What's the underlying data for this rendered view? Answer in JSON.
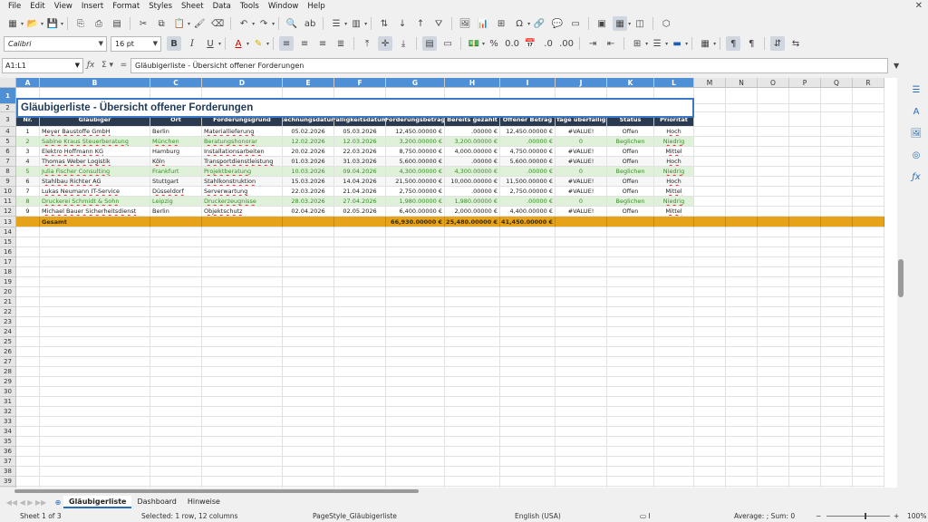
{
  "menu": [
    "File",
    "Edit",
    "View",
    "Insert",
    "Format",
    "Styles",
    "Sheet",
    "Data",
    "Tools",
    "Window",
    "Help"
  ],
  "font": {
    "name": "Calibri",
    "size": "16 pt"
  },
  "namebox": "A1:L1",
  "formula": "Gläubigerliste - Übersicht offener Forderungen",
  "columns": [
    "A",
    "B",
    "C",
    "D",
    "E",
    "F",
    "G",
    "H",
    "I",
    "J",
    "K",
    "L",
    "M",
    "N",
    "O",
    "P",
    "Q",
    "R"
  ],
  "title": "Gläubigerliste - Übersicht offener Forderungen",
  "headers": [
    "Nr.",
    "Gläubiger",
    "Ort",
    "Forderungsgrund",
    "Rechnungsdatum",
    "Fälligkeitsdatum",
    "Forderungsbetrag",
    "Bereits gezahlt",
    "Offener Betrag",
    "Tage überfällig",
    "Status",
    "Priorität"
  ],
  "rows": [
    [
      "1",
      "Meyer Baustoffe GmbH",
      "Berlin",
      "Materiallieferung",
      "05.02.2026",
      "05.03.2026",
      "12,450.00000 €",
      ".00000 €",
      "12,450.00000 €",
      "#VALUE!",
      "Offen",
      "Hoch"
    ],
    [
      "2",
      "Sabine Kraus Steuerberatung",
      "München",
      "Beratungshonorar",
      "12.02.2026",
      "12.03.2026",
      "3,200.00000 €",
      "3,200.00000 €",
      ".00000 €",
      "0",
      "Beglichen",
      "Niedrig"
    ],
    [
      "3",
      "Elektro Hoffmann KG",
      "Hamburg",
      "Installationsarbeiten",
      "20.02.2026",
      "22.03.2026",
      "8,750.00000 €",
      "4,000.00000 €",
      "4,750.00000 €",
      "#VALUE!",
      "Offen",
      "Mittel"
    ],
    [
      "4",
      "Thomas Weber Logistik",
      "Köln",
      "Transportdienstleistung",
      "01.03.2026",
      "31.03.2026",
      "5,600.00000 €",
      ".00000 €",
      "5,600.00000 €",
      "#VALUE!",
      "Offen",
      "Hoch"
    ],
    [
      "5",
      "Julia Fischer Consulting",
      "Frankfurt",
      "Projektberatung",
      "10.03.2026",
      "09.04.2026",
      "4,300.00000 €",
      "4,300.00000 €",
      ".00000 €",
      "0",
      "Beglichen",
      "Niedrig"
    ],
    [
      "6",
      "Stahlbau Richter AG",
      "Stuttgart",
      "Stahlkonstruktion",
      "15.03.2026",
      "14.04.2026",
      "21,500.00000 €",
      "10,000.00000 €",
      "11,500.00000 €",
      "#VALUE!",
      "Offen",
      "Hoch"
    ],
    [
      "7",
      "Lukas Neumann IT-Service",
      "Düsseldorf",
      "Serverwartung",
      "22.03.2026",
      "21.04.2026",
      "2,750.00000 €",
      ".00000 €",
      "2,750.00000 €",
      "#VALUE!",
      "Offen",
      "Mittel"
    ],
    [
      "8",
      "Druckerei Schmidt & Sohn",
      "Leipzig",
      "Druckerzeugnisse",
      "28.03.2026",
      "27.04.2026",
      "1,980.00000 €",
      "1,980.00000 €",
      ".00000 €",
      "0",
      "Beglichen",
      "Niedrig"
    ],
    [
      "9",
      "Michael Bauer Sicherheitsdienst",
      "Berlin",
      "Objektschutz",
      "02.04.2026",
      "02.05.2026",
      "6,400.00000 €",
      "2,000.00000 €",
      "4,400.00000 €",
      "#VALUE!",
      "Offen",
      "Mittel"
    ]
  ],
  "total": {
    "label": "Gesamt",
    "forderung": "66,930.00000 €",
    "gezahlt": "25,480.00000 €",
    "offen": "41,450.00000 €"
  },
  "tabs": [
    "Gläubigerliste",
    "Dashboard",
    "Hinweise"
  ],
  "status": {
    "sheet": "Sheet 1 of 3",
    "selected": "Selected: 1 row, 12 columns",
    "pagestyle": "PageStyle_Gläubigerliste",
    "language": "English (USA)",
    "summary": "Average: ; Sum: 0",
    "zoom": "100%"
  }
}
